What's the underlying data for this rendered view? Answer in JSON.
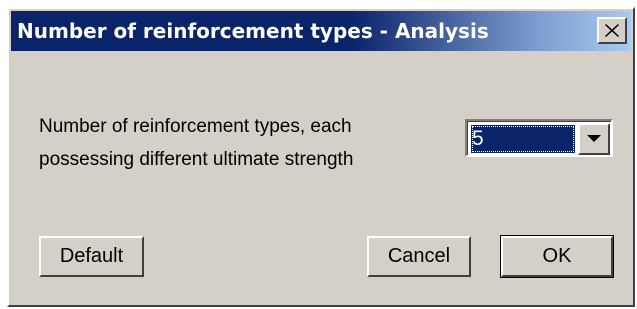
{
  "window": {
    "title": "Number of reinforcement types - Analysis",
    "close_icon": "close-icon"
  },
  "prompt": {
    "line1": "Number of reinforcement types, each",
    "line2": "possessing different ultimate strength"
  },
  "types_select": {
    "value": "5",
    "arrow_icon": "chevron-down-icon"
  },
  "buttons": {
    "default_label": "Default",
    "cancel_label": "Cancel",
    "ok_label": "OK"
  },
  "colors": {
    "titlebar": "#0a246a",
    "face": "#d4d0c8",
    "selection": "#0a246a"
  }
}
